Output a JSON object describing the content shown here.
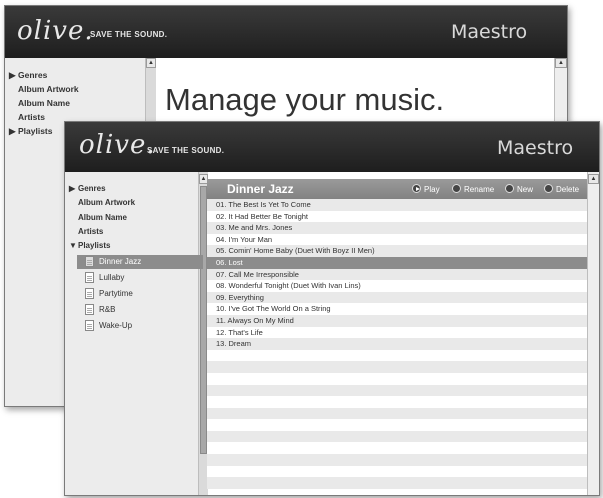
{
  "back_window": {
    "logo": "olive.",
    "tagline": "SAVE THE SOUND.",
    "app_title": "Maestro",
    "nav": [
      {
        "label": "Genres",
        "arrow": "▶"
      },
      {
        "label": "Album Artwork",
        "arrow": ""
      },
      {
        "label": "Album Name",
        "arrow": ""
      },
      {
        "label": "Artists",
        "arrow": ""
      },
      {
        "label": "Playlists",
        "arrow": "▶"
      }
    ],
    "main_heading": "Manage your music."
  },
  "front_window": {
    "logo": "olive.",
    "tagline": "SAVE THE SOUND.",
    "app_title": "Maestro",
    "nav": [
      {
        "label": "Genres",
        "arrow": "▶"
      },
      {
        "label": "Album Artwork",
        "arrow": ""
      },
      {
        "label": "Album Name",
        "arrow": ""
      },
      {
        "label": "Artists",
        "arrow": ""
      },
      {
        "label": "Playlists",
        "arrow": "▼"
      }
    ],
    "playlists": [
      {
        "label": "Dinner Jazz",
        "selected": true
      },
      {
        "label": "Lullaby",
        "selected": false
      },
      {
        "label": "Partytime",
        "selected": false
      },
      {
        "label": "R&B",
        "selected": false
      },
      {
        "label": "Wake-Up",
        "selected": false
      }
    ],
    "current_playlist": "Dinner Jazz",
    "actions": {
      "play": "Play",
      "rename": "Rename",
      "new": "New",
      "delete": "Delete"
    },
    "tracks": [
      "01. The Best Is Yet To Come",
      "02. It Had Better Be Tonight",
      "03. Me and Mrs. Jones",
      "04. I'm Your Man",
      "05. Comin' Home Baby (Duet With Boyz II Men)",
      "06. Lost",
      "07. Call Me Irresponsible",
      "08. Wonderful Tonight (Duet With Ivan Lins)",
      "09. Everything",
      "10. I've Got The World On a String",
      "11. Always On My Mind",
      "12. That's Life",
      "13. Dream"
    ],
    "selected_track_index": 5
  }
}
